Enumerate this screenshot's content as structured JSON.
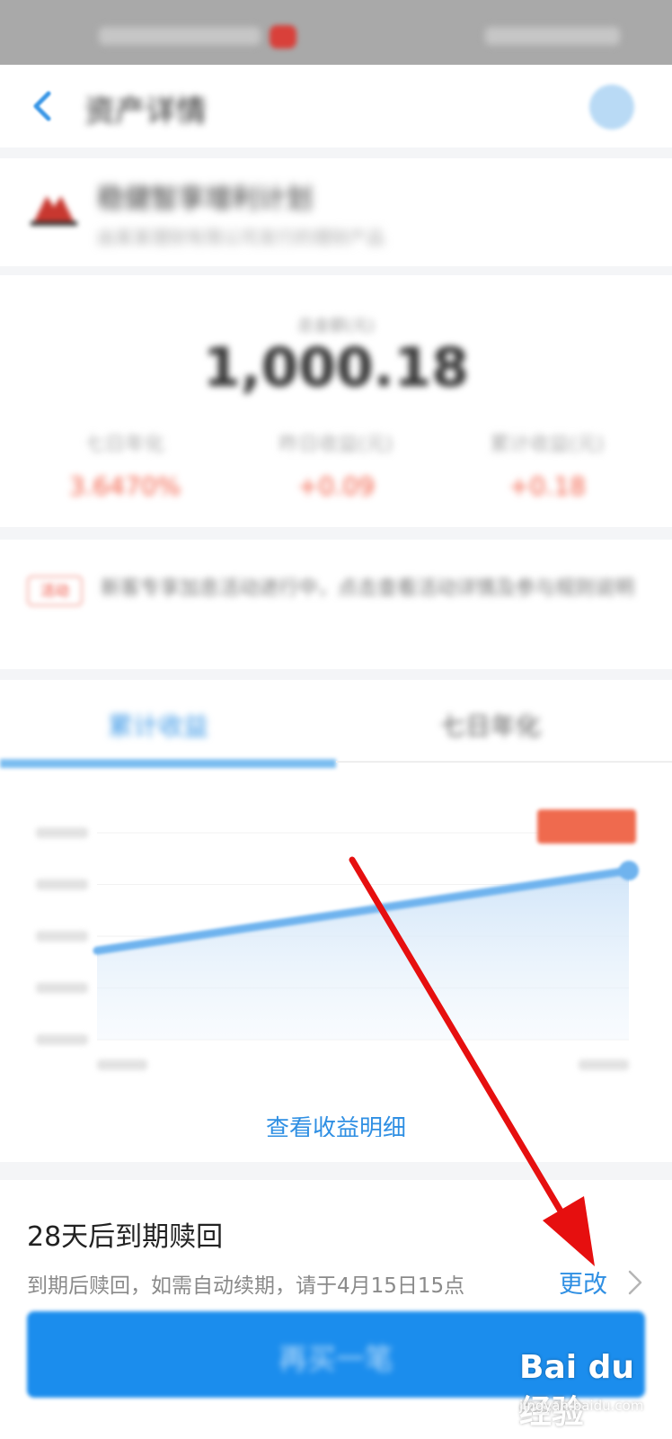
{
  "status_bar": {},
  "header": {
    "title": "资产详情",
    "back_icon": "back-arrow-icon",
    "help_icon": "help-icon"
  },
  "product": {
    "name": "稳健智享增利计划",
    "description": "由某某理财有限公司发行的理财产品"
  },
  "assets": {
    "label": "总金额(元)",
    "amount": "1,000.18",
    "stats": [
      {
        "label": "七日年化",
        "value": "3.6470%"
      },
      {
        "label": "昨日收益(元)",
        "value": "+0.09"
      },
      {
        "label": "累计收益(元)",
        "value": "+0.18"
      }
    ]
  },
  "promo": {
    "badge": "活动",
    "text": "新客专享加息活动进行中，点击查看活动详情及参与规则说明"
  },
  "chart_section": {
    "tabs": [
      {
        "label": "累计收益"
      },
      {
        "label": "七日年化"
      }
    ],
    "active_tab": 0,
    "link_label": "查看收益明细"
  },
  "chart_data": {
    "type": "area",
    "series": [
      {
        "values": [
          0.09,
          0.18
        ]
      }
    ],
    "y_ticks": [
      "",
      "",
      "",
      "",
      ""
    ],
    "x_labels": [
      "",
      ""
    ],
    "marker_label": "",
    "grid": true,
    "colors": {
      "line": "#6fb3ee",
      "fill": "#d7e9fa",
      "marker": "#ef6a4e"
    }
  },
  "redeem": {
    "title": "28天后到期赎回",
    "note": "到期后赎回，如需自动续期，请于4月15日15点",
    "change_label": "更改",
    "buy_label": "再买一笔"
  },
  "watermark": {
    "logo": "Bai du 经验",
    "url": "jingyan.baidu.com"
  },
  "colors": {
    "accent": "#2f8fe3",
    "positive": "#f25a42",
    "annotation_arrow": "#e60f0f"
  }
}
